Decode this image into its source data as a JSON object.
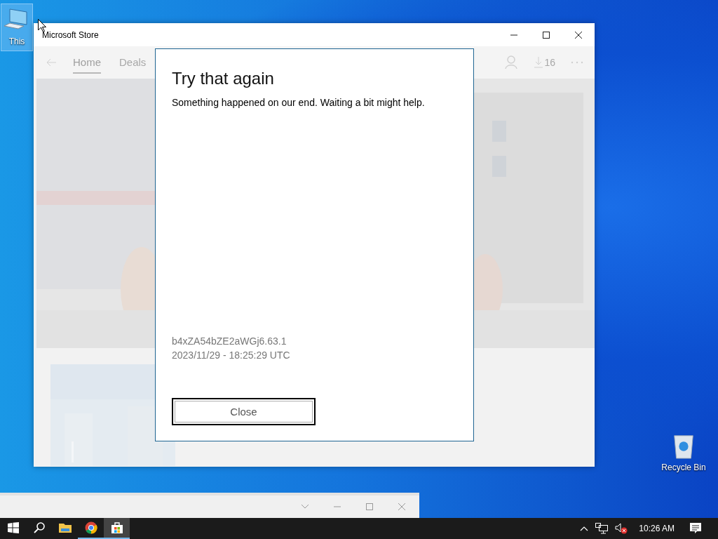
{
  "desktop_icons": [
    {
      "kind": "computer",
      "label": "This",
      "selected": true
    },
    {
      "kind": "recycle",
      "label": "Recycle Bin",
      "selected": false
    }
  ],
  "store_window": {
    "title": "Microsoft Store",
    "nav": [
      {
        "label": "Home",
        "selected": true
      },
      {
        "label": "Deals",
        "selected": false
      }
    ],
    "downloads": "16"
  },
  "dialog": {
    "title": "Try that again",
    "message": "Something happened on our end. Waiting a bit might help.",
    "code": "b4xZA54bZE2aWGj6.63.1",
    "timestamp": "2023/11/29 - 18:25:29 UTC",
    "button": "Close"
  },
  "taskbar": {
    "apps": [
      {
        "kind": "explorer",
        "running": false,
        "active": false
      },
      {
        "kind": "chrome",
        "running": true,
        "active": false
      },
      {
        "kind": "store",
        "running": true,
        "active": true
      }
    ],
    "clock": "10:26 AM"
  }
}
